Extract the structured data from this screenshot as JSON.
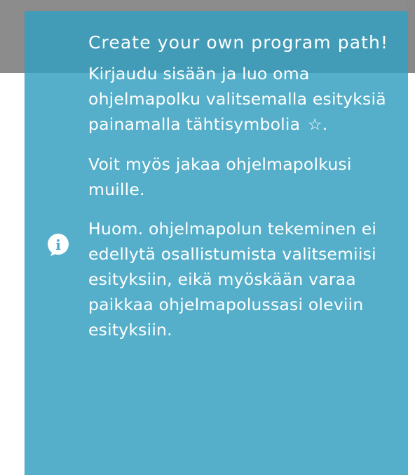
{
  "panel": {
    "title": "Create your own program path!",
    "paragraph_1": "Kirjaudu sisään ja luo oma ohjelmapolku valitsemalla esityksiä painamalla tähtisymbolia",
    "star_glyph": "☆",
    "star_suffix": ".",
    "paragraph_2": "Voit myös jakaa ohjelmapolkusi muille.",
    "paragraph_3": "Huom. ohjelmapolun tekeminen ei edellytä osallistumista valitsemiisi esityksiin, eikä myöskään varaa paikkaa ohjelmapolussasi oleviin esityksiin.",
    "icon": "info-icon"
  },
  "colors": {
    "panel_background": "#4aa9c3",
    "page_background": "#ffffff",
    "top_band": "#8c8c8c",
    "text": "#ffffff"
  }
}
